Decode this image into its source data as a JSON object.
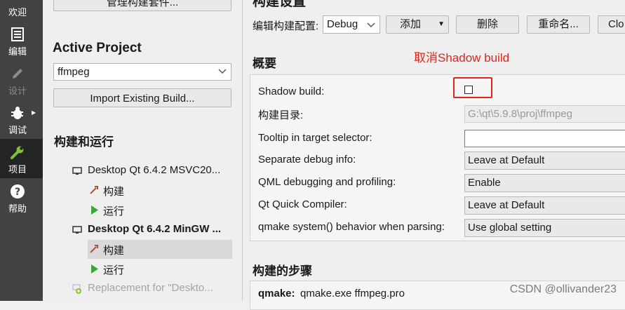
{
  "modebar": {
    "items": [
      {
        "label": "欢迎",
        "icon": "welcome-icon"
      },
      {
        "label": "编辑",
        "icon": "edit-icon"
      },
      {
        "label": "设计",
        "icon": "design-pencil-icon"
      },
      {
        "label": "调试",
        "icon": "debug-bug-icon"
      },
      {
        "label": "项目",
        "icon": "wrench-icon"
      },
      {
        "label": "帮助",
        "icon": "help-icon"
      }
    ]
  },
  "panel": {
    "manage_kits_label": "管理构建套件...",
    "active_project_heading": "Active Project",
    "project_combo_value": "ffmpeg",
    "import_button_label": "Import Existing Build...",
    "build_run_heading": "构建和运行",
    "tree": [
      {
        "label": "Desktop Qt 6.4.2 MSVC20...",
        "icon": "monitor-icon"
      },
      {
        "label": "构建",
        "icon": "hammer-icon"
      },
      {
        "label": "运行",
        "icon": "play-icon"
      },
      {
        "label": "Desktop Qt 6.4.2 MinGW ...",
        "icon": "monitor-icon"
      },
      {
        "label": "构建",
        "icon": "hammer-icon"
      },
      {
        "label": "运行",
        "icon": "play-icon"
      },
      {
        "label": "Replacement for \"Deskto...",
        "icon": "add-kit-icon"
      }
    ]
  },
  "settings": {
    "title": "构建设置",
    "config_label": "编辑构建配置:",
    "config_value": "Debug",
    "add_button": "添加",
    "delete_button": "删除",
    "rename_button": "重命名...",
    "clone_button": "Clo",
    "overview_heading": "概要",
    "annotation": "取消Shadow build",
    "shadow_build_label": "Shadow build:",
    "shadow_build_checked": false,
    "build_dir_label": "构建目录:",
    "build_dir_value": "G:\\qt\\5.9.8\\proj\\ffmpeg",
    "tooltip_label": "Tooltip in target selector:",
    "tooltip_value": "",
    "sep_debug_label": "Separate debug info:",
    "sep_debug_value": "Leave at Default",
    "qml_debug_label": "QML debugging and profiling:",
    "qml_debug_value": "Enable",
    "qtquick_label": "Qt Quick Compiler:",
    "qtquick_value": "Leave at Default",
    "qmake_system_label": "qmake system() behavior when parsing:",
    "qmake_system_value": "Use global setting",
    "steps_heading": "构建的步骤",
    "step_qmake_key": "qmake:",
    "step_qmake_value": "qmake.exe ffmpeg.pro"
  },
  "watermark": "CSDN @ollivander23",
  "colors": {
    "modebar_bg": "#404244",
    "modebar_active": "#232426",
    "annotation_red": "#e0241b"
  }
}
